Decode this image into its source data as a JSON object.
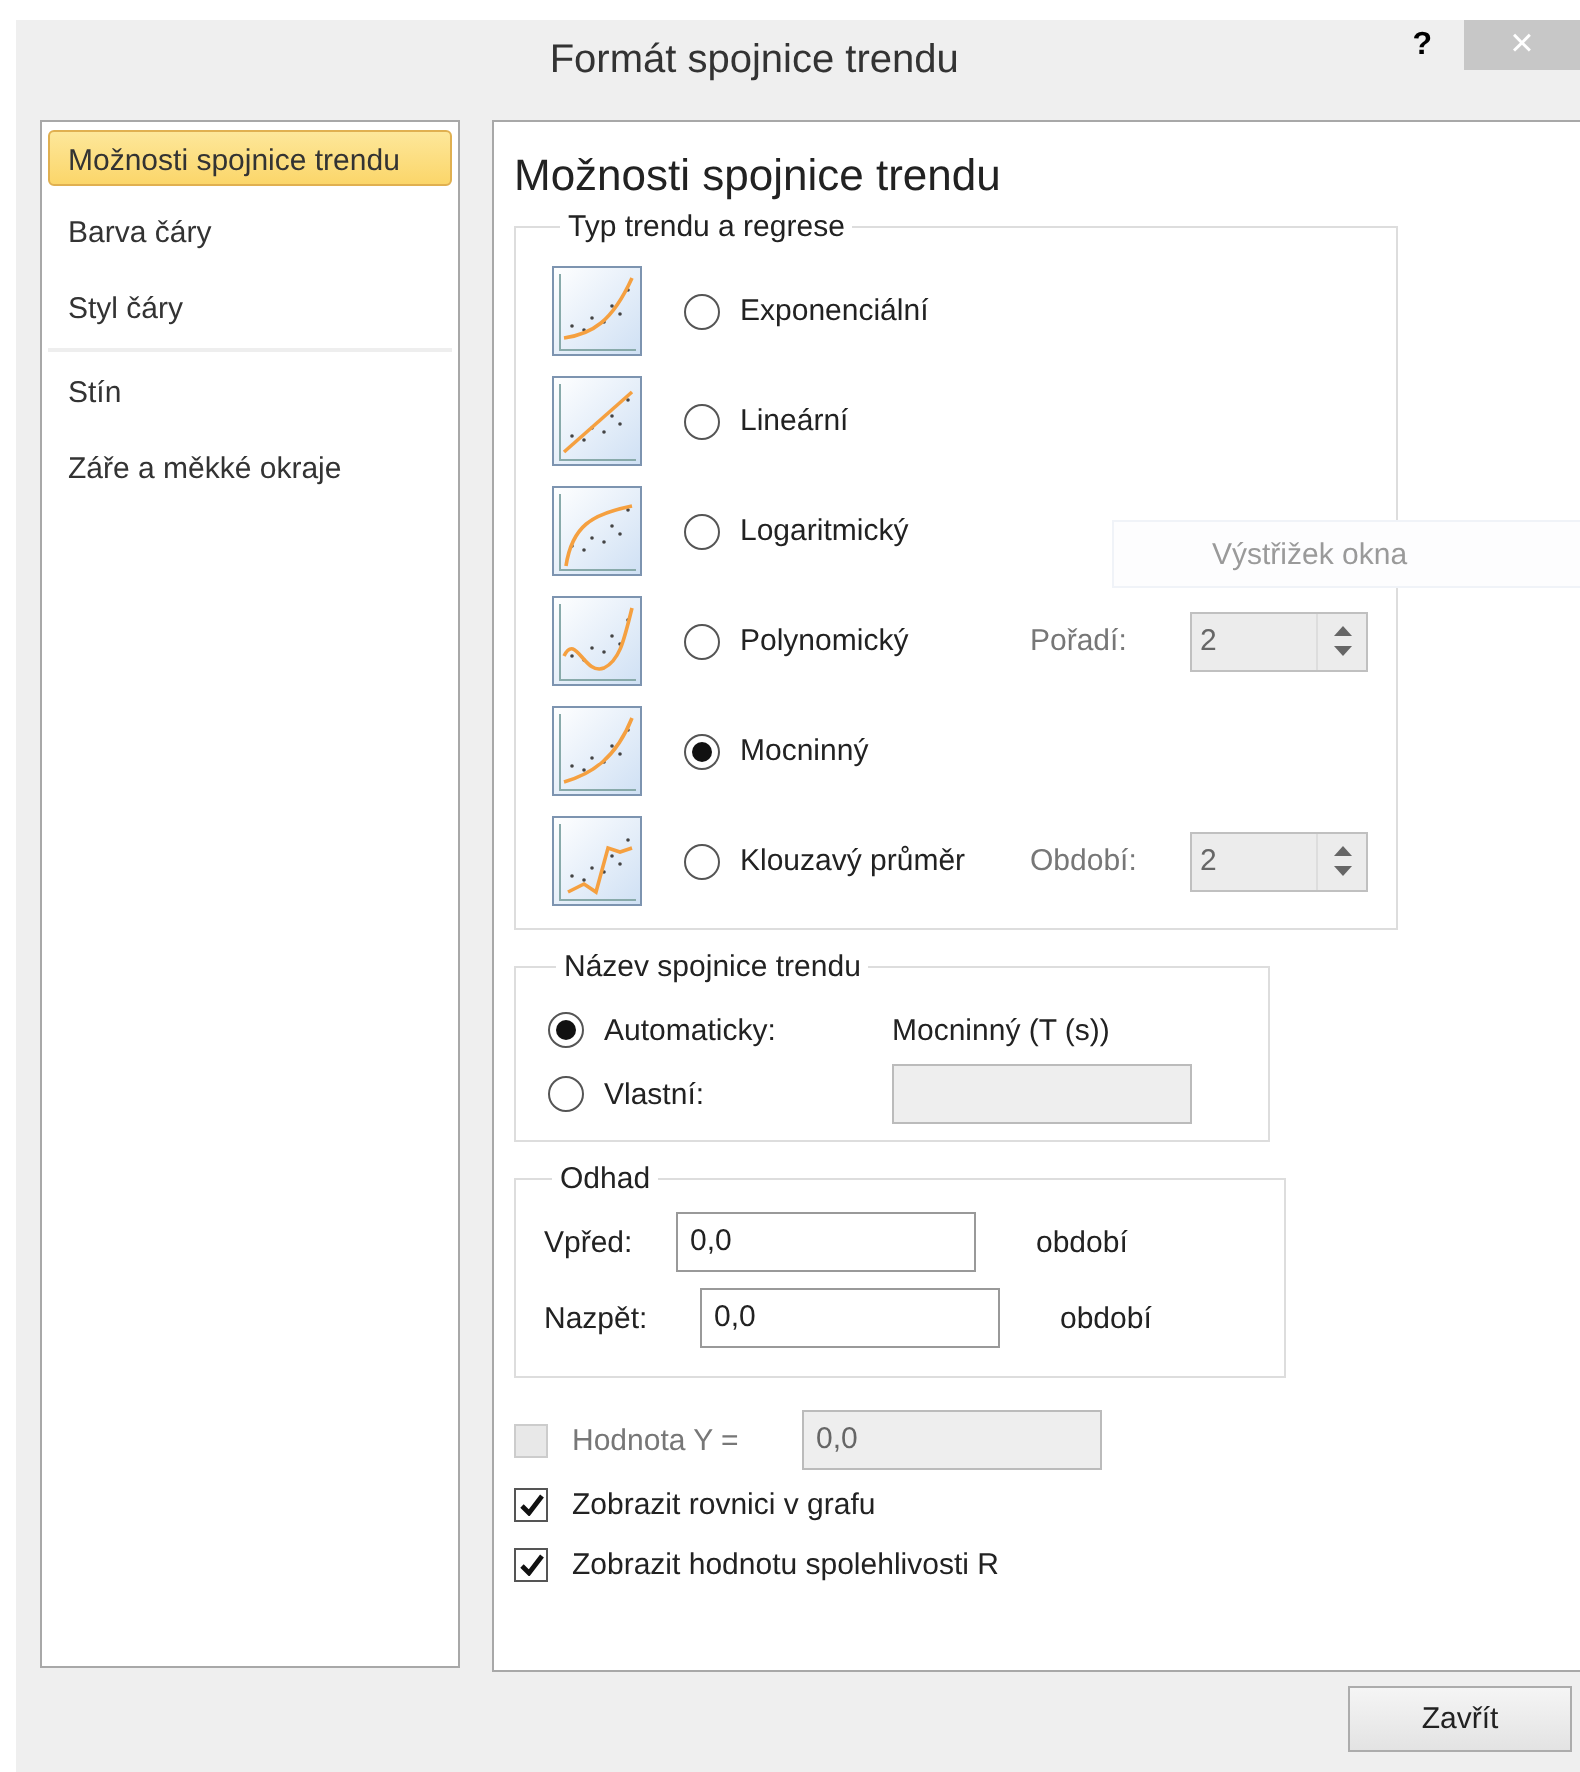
{
  "window": {
    "title": "Formát spojnice trendu",
    "help": "?",
    "close": "×"
  },
  "sidebar": {
    "items": [
      {
        "label": "Možnosti spojnice trendu",
        "selected": true,
        "separator_after": false
      },
      {
        "label": "Barva čáry",
        "selected": false,
        "separator_after": false
      },
      {
        "label": "Styl čáry",
        "selected": false,
        "separator_after": true
      },
      {
        "label": "Stín",
        "selected": false,
        "separator_after": false
      },
      {
        "label": "Záře a měkké okraje",
        "selected": false,
        "separator_after": false
      }
    ]
  },
  "panel": {
    "heading": "Možnosti spojnice trendu"
  },
  "trend_type": {
    "legend": "Typ trendu a regrese",
    "options": [
      {
        "label": "Exponenciální",
        "selected": false,
        "kind": "exponential"
      },
      {
        "label": "Lineární",
        "selected": false,
        "kind": "linear"
      },
      {
        "label": "Logaritmický",
        "selected": false,
        "kind": "logarithmic"
      },
      {
        "label": "Polynomický",
        "selected": false,
        "kind": "polynomial",
        "param": {
          "label": "Pořadí:",
          "value": "2",
          "disabled": true
        }
      },
      {
        "label": "Mocninný",
        "selected": true,
        "kind": "power"
      },
      {
        "label": "Klouzavý průměr",
        "selected": false,
        "kind": "moving_average",
        "param": {
          "label": "Období:",
          "value": "2",
          "disabled": true
        }
      }
    ]
  },
  "trend_name": {
    "legend": "Název spojnice trendu",
    "options": [
      {
        "label": "Automaticky:",
        "selected": true,
        "kind": "text",
        "value": "Mocninný (T (s))"
      },
      {
        "label": "Vlastní:",
        "selected": false,
        "kind": "field"
      }
    ]
  },
  "forecast": {
    "legend": "Odhad",
    "rows": [
      {
        "label": "Vpřed:",
        "value": "0,0",
        "unit": "období"
      },
      {
        "label": "Nazpět:",
        "value": "0,0",
        "unit": "období"
      }
    ]
  },
  "intercept": {
    "label": "Hodnota Y =",
    "value": "0,0",
    "checked": false,
    "disabled": true
  },
  "checkboxes": [
    {
      "label": "Zobrazit rovnici v grafu",
      "checked": true
    },
    {
      "label": "Zobrazit hodnotu spolehlivosti R",
      "checked": true
    }
  ],
  "buttons": [
    "Zavřít"
  ],
  "overlay_tooltip": {
    "text": "Výstřižek okna"
  }
}
